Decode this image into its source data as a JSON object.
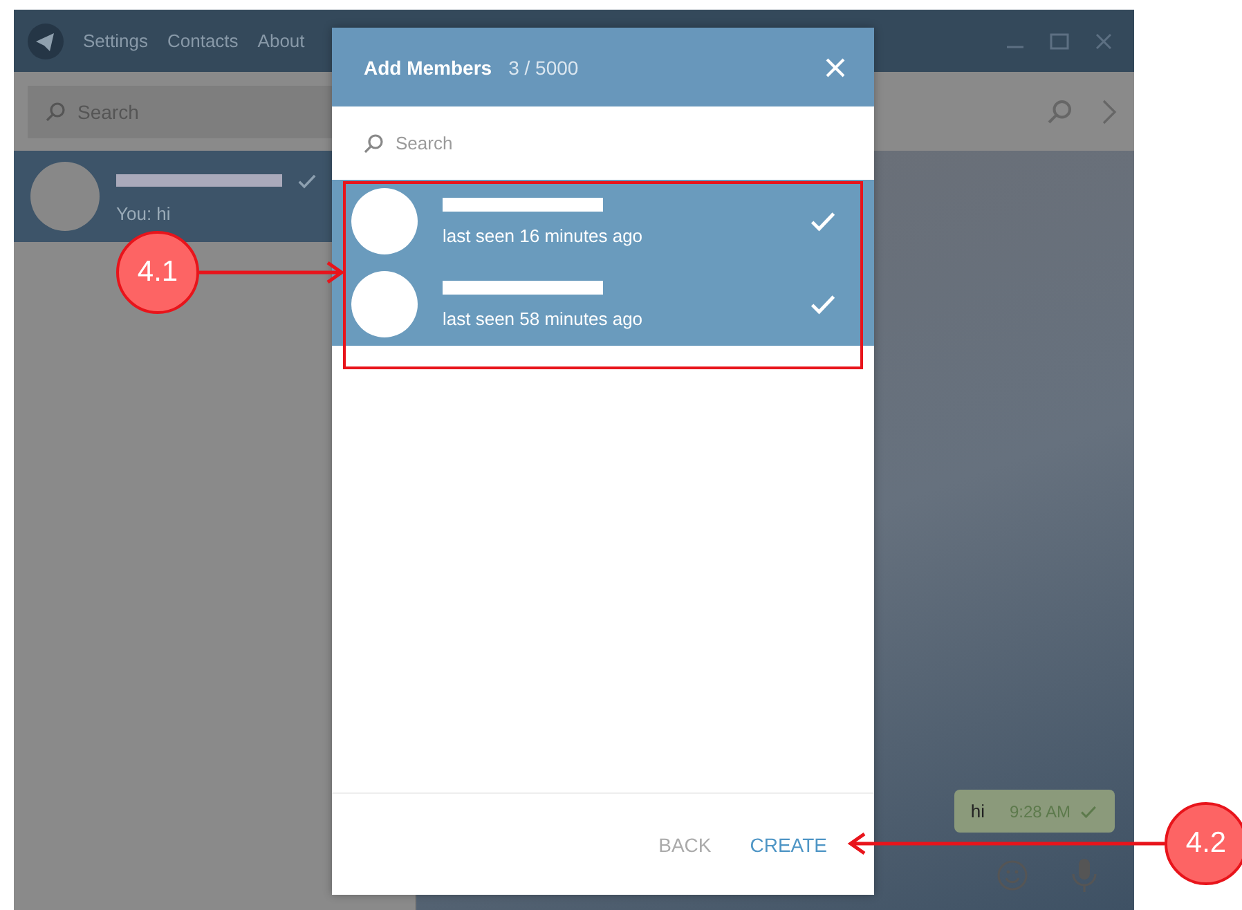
{
  "window": {
    "menu": [
      "Settings",
      "Contacts",
      "About"
    ]
  },
  "sidebar": {
    "search": {
      "placeholder": "Search"
    },
    "chats": [
      {
        "preview": "You: hi",
        "selected": true,
        "read": true
      }
    ]
  },
  "chat": {
    "messages": [
      {
        "text": "hi",
        "time": "9:28 AM",
        "read": true
      }
    ]
  },
  "dialog": {
    "title": "Add Members",
    "count": "3 / 5000",
    "search": {
      "placeholder": "Search"
    },
    "members": [
      {
        "status": "last seen 16 minutes ago",
        "selected": true
      },
      {
        "status": "last seen 58 minutes ago",
        "selected": true
      }
    ],
    "buttons": [
      {
        "label": "BACK",
        "kind": "secondary"
      },
      {
        "label": "CREATE",
        "kind": "primary"
      }
    ]
  },
  "annotations": [
    {
      "label": "4.1",
      "kind": "members"
    },
    {
      "label": "4.2",
      "kind": "create"
    }
  ]
}
